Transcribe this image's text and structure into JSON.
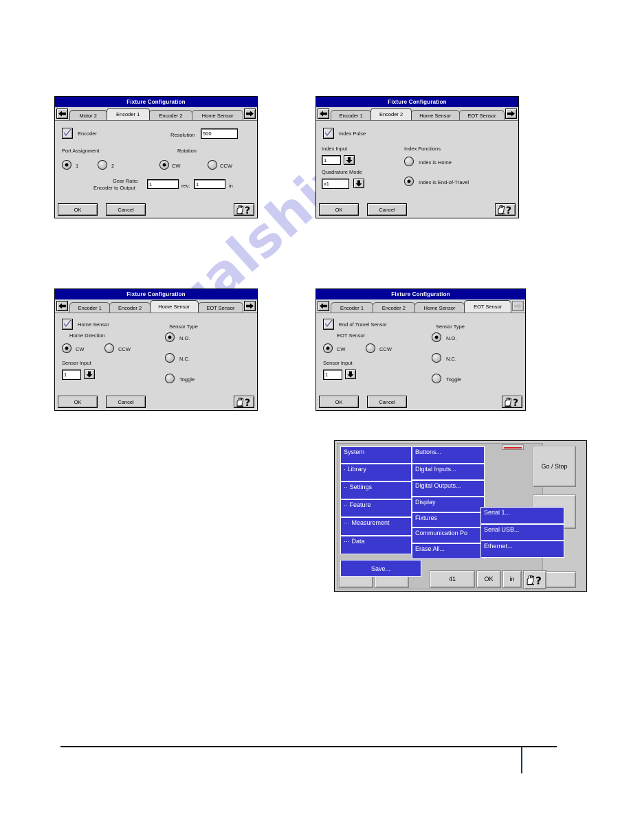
{
  "watermark": {
    "text": "manualshive.com"
  },
  "dialogs": [
    {
      "id": "encoder1",
      "title": "Fixture Configuration",
      "nav": {
        "prev_icon": "left-arrow-icon",
        "next_icon": "right-arrow-icon",
        "next_disabled": false
      },
      "tabs": [
        {
          "label": "Motor 2",
          "active": false
        },
        {
          "label": "Encoder 1",
          "active": true
        },
        {
          "label": "Encoder 2",
          "active": false
        },
        {
          "label": "Home Sensor",
          "active": false
        }
      ],
      "checkbox": {
        "label": "Encoder",
        "checked": true
      },
      "resolution": {
        "label": "Resolution",
        "value": "500"
      },
      "port_assignment": {
        "label": "Port Assignment",
        "options": [
          "1",
          "2"
        ],
        "selected": "1"
      },
      "rotation": {
        "label": "Rotation",
        "options": [
          "CW",
          "CCW"
        ],
        "selected": "CW"
      },
      "gear_ratio": {
        "line1": "Gear Ratio",
        "line2": "Encoder to Output",
        "value_left": "1",
        "middle_label": "rev:",
        "value_right": "1",
        "unit": "in"
      },
      "ok_label": "OK",
      "cancel_label": "Cancel",
      "help_icon": "hand-question-help-icon"
    },
    {
      "id": "encoder2",
      "title": "Fixture Configuration",
      "nav": {
        "prev_icon": "left-arrow-icon",
        "next_icon": "right-arrow-icon",
        "next_disabled": false
      },
      "tabs": [
        {
          "label": "Encoder 1",
          "active": false
        },
        {
          "label": "Encoder 2",
          "active": true
        },
        {
          "label": "Home Sensor",
          "active": false
        },
        {
          "label": "EOT Sensor",
          "active": false
        }
      ],
      "checkbox": {
        "label": "Index Pulse",
        "checked": true
      },
      "index_input": {
        "label": "Index Input",
        "value": "1",
        "spinner_icon": "down-arrow-icon"
      },
      "quadrature_mode": {
        "label": "Quadrature Mode",
        "value": "x1",
        "spinner_icon": "down-arrow-icon"
      },
      "index_functions": {
        "label": "Index Functions",
        "options": [
          "Index is Home",
          "Index is End-of-Travel"
        ],
        "selected": "Index is End-of-Travel"
      },
      "ok_label": "OK",
      "cancel_label": "Cancel",
      "help_icon": "hand-question-help-icon"
    },
    {
      "id": "home-sensor",
      "title": "Fixture Configuration",
      "nav": {
        "prev_icon": "left-arrow-icon",
        "next_icon": "right-arrow-icon",
        "next_disabled": false
      },
      "tabs": [
        {
          "label": "Encoder 1",
          "active": false
        },
        {
          "label": "Encoder 2",
          "active": false
        },
        {
          "label": "Home Sensor",
          "active": true
        },
        {
          "label": "EOT Sensor",
          "active": false
        }
      ],
      "checkbox": {
        "label": "Home Sensor",
        "checked": true
      },
      "direction": {
        "label": "Home Direction",
        "options": [
          "CW",
          "CCW"
        ],
        "selected": "CW"
      },
      "sensor_input": {
        "label": "Sensor Input",
        "value": "1",
        "spinner_icon": "down-arrow-icon"
      },
      "sensor_type": {
        "label": "Sensor Type",
        "options": [
          "N.O.",
          "N.C.",
          "Toggle"
        ],
        "selected": "N.O."
      },
      "ok_label": "OK",
      "cancel_label": "Cancel",
      "help_icon": "hand-question-help-icon"
    },
    {
      "id": "eot-sensor",
      "title": "Fixture Configuration",
      "nav": {
        "prev_icon": "left-arrow-icon",
        "next_icon": "right-arrow-icon",
        "next_disabled": true
      },
      "tabs": [
        {
          "label": "Encoder 1",
          "active": false
        },
        {
          "label": "Encoder 2",
          "active": false
        },
        {
          "label": "Home Sensor",
          "active": false
        },
        {
          "label": "EOT Sensor",
          "active": true
        }
      ],
      "checkbox": {
        "label": "End of Travel Sensor",
        "checked": true
      },
      "direction": {
        "label": "EOT Sensor",
        "options": [
          "CW",
          "CCW"
        ],
        "selected": "CW"
      },
      "sensor_input": {
        "label": "Sensor Input",
        "value": "1",
        "spinner_icon": "down-arrow-icon"
      },
      "sensor_type": {
        "label": "Sensor Type",
        "options": [
          "N.O.",
          "N.C.",
          "Toggle"
        ],
        "selected": "N.O."
      },
      "ok_label": "OK",
      "cancel_label": "Cancel",
      "help_icon": "hand-question-help-icon"
    }
  ],
  "menu_screenshot": {
    "column1": [
      {
        "label": "System"
      },
      {
        "label": "· Library"
      },
      {
        "label": "·· Settings"
      },
      {
        "label": "·· Feature"
      },
      {
        "label": "··· Measurement"
      },
      {
        "label": "··· Data"
      }
    ],
    "save_label": "Save...",
    "column2": [
      {
        "label": "Buttons..."
      },
      {
        "label": "Digital Inputs..."
      },
      {
        "label": "Digital Outputs..."
      },
      {
        "label": "Display"
      },
      {
        "label": "Fixtures"
      },
      {
        "label": "Communication Po"
      },
      {
        "label": "Erase All..."
      }
    ],
    "column3": [
      {
        "label": "Serial 1..."
      },
      {
        "label": "Serial USB..."
      },
      {
        "label": "Ethernet..."
      }
    ],
    "go_stop_label": "Go / Stop",
    "status_value": "41",
    "ok_label": "OK",
    "unit_label": "in",
    "help_icon": "hand-question-help-icon"
  },
  "colors": {
    "titlebar_blue": "#000099",
    "menu_blue": "#3b38cf",
    "dialog_gray": "#d8d8d8",
    "footer_tick": "#0b3a5e"
  }
}
